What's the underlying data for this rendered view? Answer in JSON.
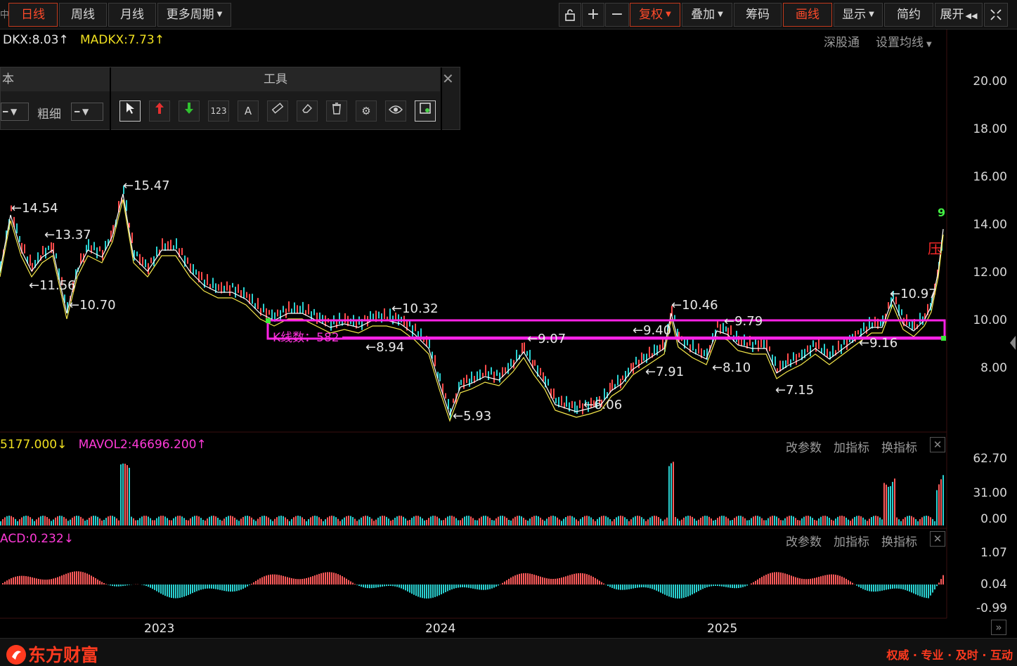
{
  "toolbar": {
    "left_partial": "中",
    "tabs": [
      "日线",
      "周线",
      "月线",
      "更多周期"
    ],
    "right": {
      "fuquan": "复权",
      "diejia": "叠加",
      "chouma": "筹码",
      "huaxian": "画线",
      "xianshi": "显示",
      "jianyue": "简约",
      "zhankai": "展开"
    }
  },
  "main": {
    "indicator_dkx": "DKX:8.03",
    "indicator_madkx": "MADKX:7.73",
    "links": [
      "深股通",
      "设置均线"
    ],
    "price_axis": [
      "20.00",
      "18.00",
      "16.00",
      "14.00",
      "12.00",
      "10.00",
      "8.00"
    ],
    "annotations": [
      "←15.47",
      "←14.54",
      "←13.37",
      "←11.56",
      "←10.70",
      "←10.32",
      "←8.94",
      "←5.93",
      "←9.07",
      "←6.06",
      "←9.40",
      "←7.91",
      "←10.46",
      "←9.79",
      "←8.10",
      "←7.15",
      "←10.97",
      "←9.16"
    ],
    "kline_count": "K线数：582",
    "tag_pressure": "压",
    "tag_nine": "9"
  },
  "toolpanel": {
    "left_header": "本",
    "header": "工具",
    "label_thickness": "粗细",
    "tools": [
      "select",
      "up-arrow",
      "down-arrow",
      "number",
      "text",
      "ruler",
      "eraser",
      "delete",
      "settings",
      "view",
      "snapshot"
    ]
  },
  "volume": {
    "ind1": "5177.000",
    "ind2": "MAVOL2:46696.200",
    "axis": [
      "62.70",
      "31.00",
      "0.00"
    ],
    "links": [
      "改参数",
      "加指标",
      "换指标"
    ]
  },
  "macd": {
    "ind1": "ACD:0.232",
    "axis": [
      "1.07",
      "0.04",
      "-0.99"
    ],
    "links": [
      "改参数",
      "加指标",
      "换指标"
    ]
  },
  "xaxis": [
    "2023",
    "2024",
    "2025"
  ],
  "footer": {
    "brand": "东方财富",
    "slogan": "权威 · 专业 · 及时 · 互动"
  }
}
